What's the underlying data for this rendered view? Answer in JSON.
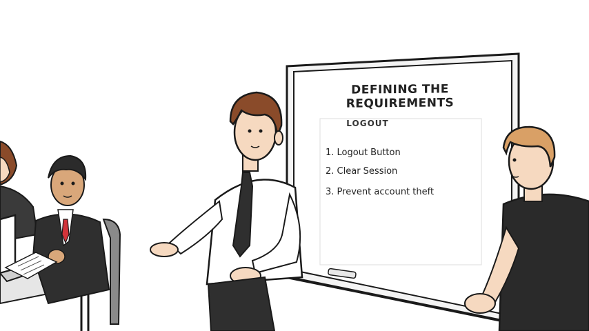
{
  "whiteboard": {
    "title": "DEFINING THE REQUIREMENTS",
    "paper": {
      "heading": "LOGOUT",
      "items": [
        "1. Logout Button",
        "2. Clear Session",
        "3. Prevent account theft"
      ]
    }
  },
  "colors": {
    "outline": "#1a1a1a",
    "hair_brown": "#8a4b2a",
    "hair_blonde": "#d9a066",
    "hair_dark": "#2b2b2b",
    "skin": "#f6d9c0",
    "skin_tan": "#d9a77a",
    "suit": "#2f2f2f",
    "tie_red": "#d2343a",
    "tshirt": "#2a2a2a",
    "shirt_white": "#ffffff"
  }
}
